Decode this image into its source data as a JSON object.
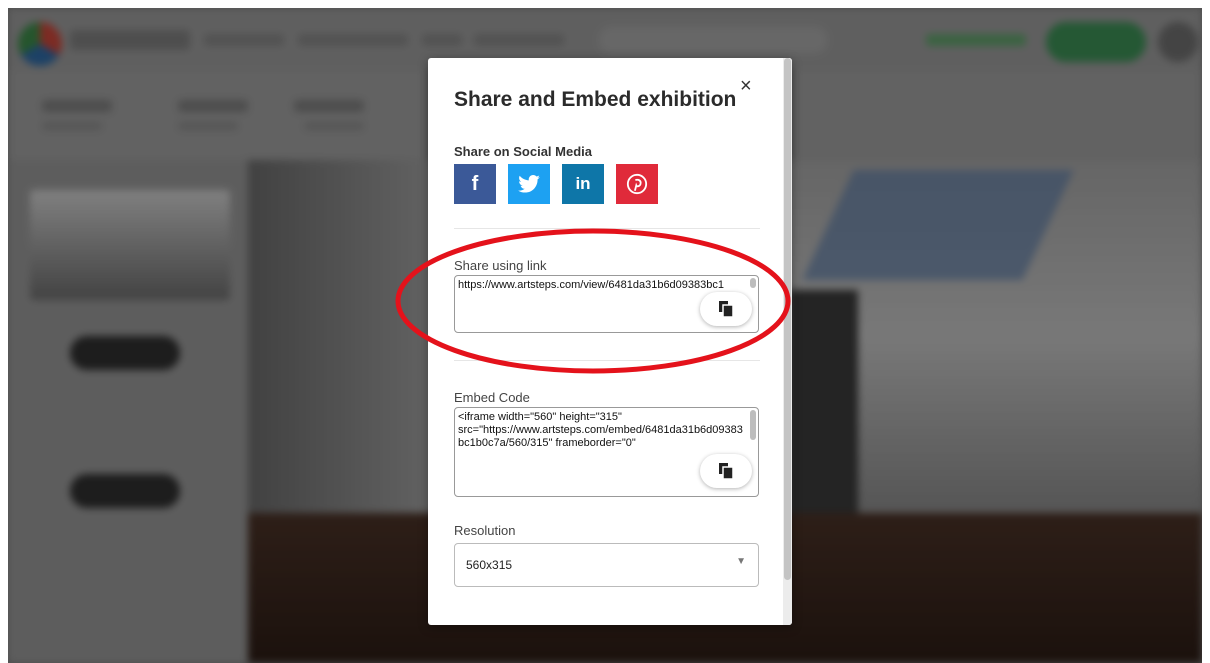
{
  "modal": {
    "title": "Share and Embed exhibition",
    "close_glyph": "×",
    "social": {
      "heading": "Share on Social Media",
      "buttons": [
        {
          "label": "f",
          "icon": "facebook-icon",
          "color": "#3b5998"
        },
        {
          "label": "🐦",
          "icon": "twitter-icon",
          "color": "#1da1f2"
        },
        {
          "label": "in",
          "icon": "linkedin-icon",
          "color": "#0e76a8"
        },
        {
          "label": "p",
          "icon": "pinterest-icon",
          "color": "#e02a3a"
        }
      ]
    },
    "link": {
      "label": "Share using link",
      "value": "https://www.artsteps.com/view/6481da31b6d09383bc1"
    },
    "embed": {
      "label": "Embed Code",
      "value": "<iframe width=\"560\" height=\"315\"\nsrc=\"https://www.artsteps.com/embed/6481da31b6d09383bc1b0c7a/560/315\" frameborder=\"0\""
    },
    "resolution": {
      "label": "Resolution",
      "value": "560x315"
    }
  },
  "annotation": {
    "color": "#e4121b"
  }
}
